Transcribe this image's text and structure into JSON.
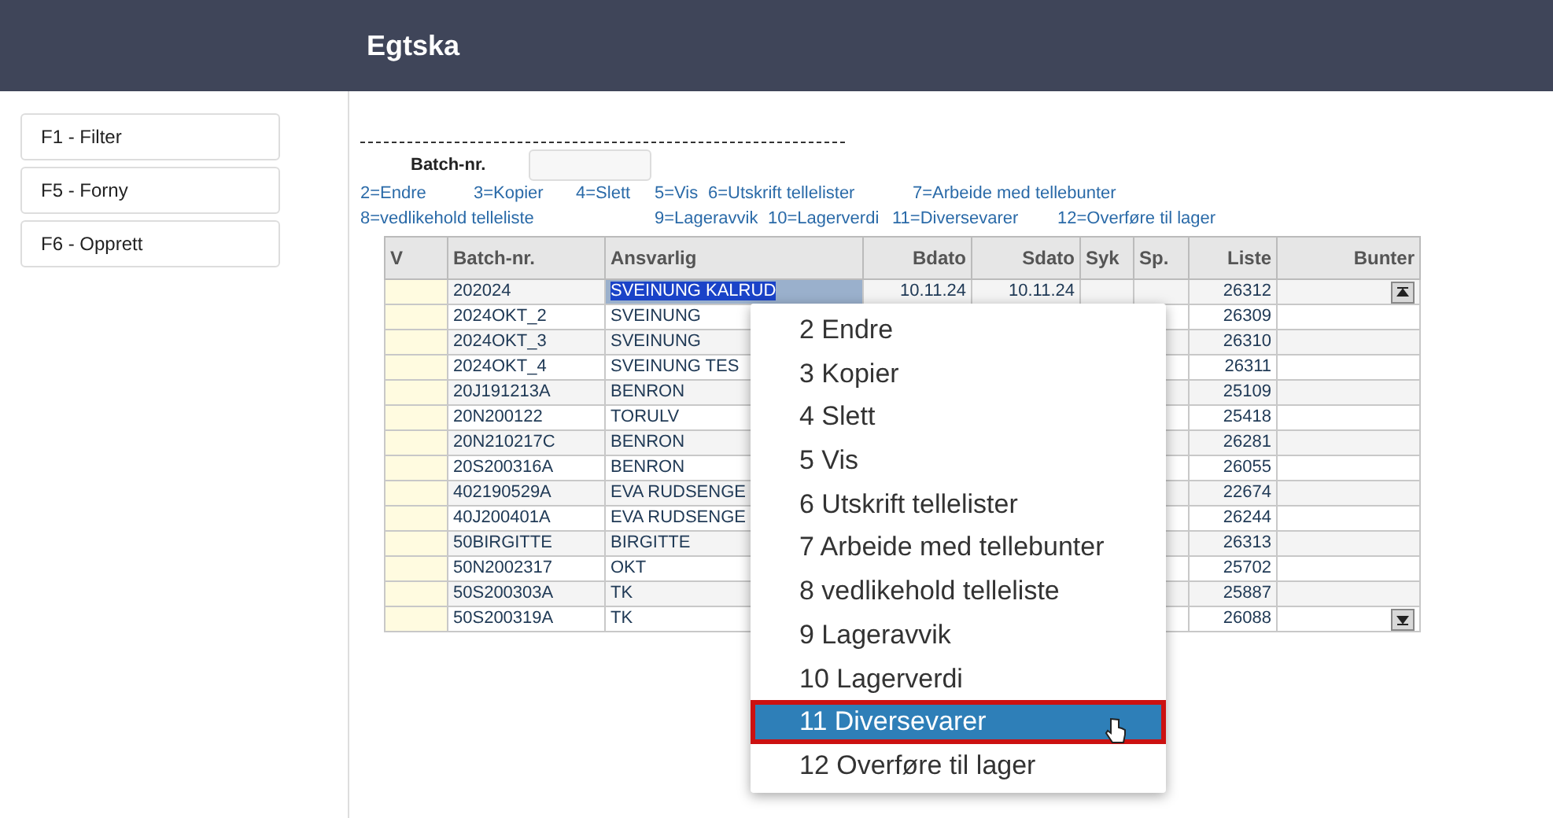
{
  "header": {
    "title": "Egtska"
  },
  "sidebar": {
    "buttons": [
      "F1 - Filter",
      "F5 - Forny",
      "F6 - Opprett"
    ]
  },
  "filter": {
    "label": "Batch-nr."
  },
  "legend": [
    [
      "2=Endre",
      "3=Kopier",
      "4=Slett",
      "5=Vis",
      "6=Utskrift tellelister",
      "7=Arbeide med tellebunter"
    ],
    [
      "8=vedlikehold telleliste",
      "9=Lageravvik",
      "10=Lagerverdi",
      "11=Diversevarer",
      "12=Overføre til lager"
    ]
  ],
  "table": {
    "columns": [
      "V",
      "Batch-nr.",
      "Ansvarlig",
      "Bdato",
      "Sdato",
      "Syk",
      "Sp.",
      "Liste",
      "Bunter"
    ],
    "rows": [
      {
        "batch": "202024",
        "ansvarlig": "SVEINUNG KALRUD",
        "bdato": "10.11.24",
        "sdato": "10.11.24",
        "liste": "26312",
        "selected": true
      },
      {
        "batch": "2024OKT_2",
        "ansvarlig": "SVEINUNG",
        "liste": "26309",
        "selected": false
      },
      {
        "batch": "2024OKT_3",
        "ansvarlig": "SVEINUNG",
        "liste": "26310",
        "selected": false
      },
      {
        "batch": "2024OKT_4",
        "ansvarlig": "SVEINUNG TES",
        "liste": "26311",
        "selected": false
      },
      {
        "batch": "20J191213A",
        "ansvarlig": "BENRON",
        "liste": "25109",
        "selected": false
      },
      {
        "batch": "20N200122",
        "ansvarlig": "TORULV",
        "liste": "25418",
        "selected": false
      },
      {
        "batch": "20N210217C",
        "ansvarlig": "BENRON",
        "liste": "26281",
        "selected": false
      },
      {
        "batch": "20S200316A",
        "ansvarlig": "BENRON",
        "liste": "26055",
        "selected": false
      },
      {
        "batch": "402190529A",
        "ansvarlig": "EVA RUDSENGE",
        "liste": "22674",
        "selected": false
      },
      {
        "batch": "40J200401A",
        "ansvarlig": "EVA RUDSENGE",
        "liste": "26244",
        "selected": false
      },
      {
        "batch": "50BIRGITTE",
        "ansvarlig": "BIRGITTE",
        "liste": "26313",
        "selected": false
      },
      {
        "batch": "50N2002317",
        "ansvarlig": "OKT",
        "liste": "25702",
        "selected": false
      },
      {
        "batch": "50S200303A",
        "ansvarlig": "TK",
        "liste": "25887",
        "selected": false
      },
      {
        "batch": "50S200319A",
        "ansvarlig": "TK",
        "liste": "26088",
        "selected": false
      }
    ]
  },
  "context_menu": {
    "items": [
      {
        "label": "2 Endre",
        "selected": false,
        "outlined": false
      },
      {
        "label": "3 Kopier",
        "selected": false,
        "outlined": false
      },
      {
        "label": "4 Slett",
        "selected": false,
        "outlined": false
      },
      {
        "label": "5 Vis",
        "selected": false,
        "outlined": false
      },
      {
        "label": "6 Utskrift tellelister",
        "selected": false,
        "outlined": false
      },
      {
        "label": "7 Arbeide med tellebunter",
        "selected": false,
        "outlined": false
      },
      {
        "label": "8 vedlikehold telleliste",
        "selected": false,
        "outlined": false
      },
      {
        "label": "9 Lageravvik",
        "selected": false,
        "outlined": false
      },
      {
        "label": "10 Lagerverdi",
        "selected": false,
        "outlined": false
      },
      {
        "label": "11 Diversevarer",
        "selected": true,
        "outlined": true
      },
      {
        "label": "12 Overføre til lager",
        "selected": false,
        "outlined": false
      }
    ]
  }
}
